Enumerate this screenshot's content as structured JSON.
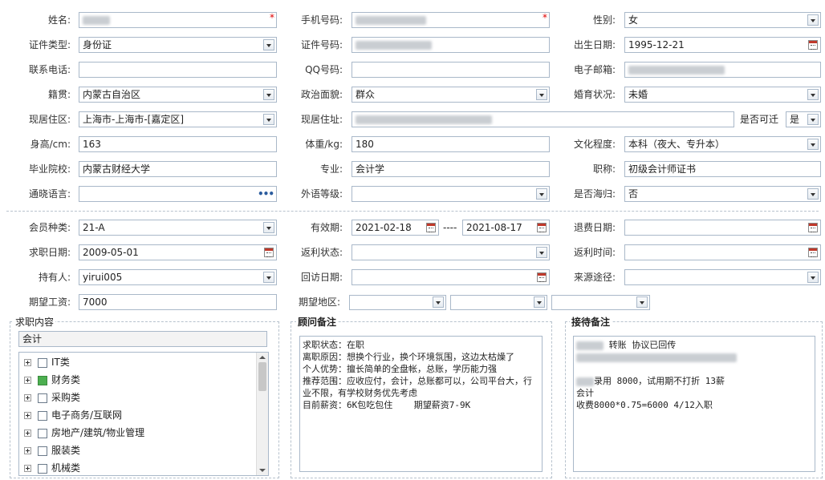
{
  "row1": {
    "name_label": "姓名:",
    "phone_label": "手机号码:",
    "gender_label": "性别:",
    "gender_value": "女",
    "required_mark": "*"
  },
  "row2": {
    "idtype_label": "证件类型:",
    "idtype_value": "身份证",
    "idno_label": "证件号码:",
    "birth_label": "出生日期:",
    "birth_value": "1995-12-21"
  },
  "row3": {
    "tel_label": "联系电话:",
    "qq_label": "QQ号码:",
    "email_label": "电子邮箱:"
  },
  "row4": {
    "native_label": "籍贯:",
    "native_value": "内蒙古自治区",
    "political_label": "政治面貌:",
    "political_value": "群众",
    "marital_label": "婚育状况:",
    "marital_value": "未婚"
  },
  "row5": {
    "residence_label": "现居住区:",
    "residence_value": "上海市-上海市-[嘉定区]",
    "address_label": "现居住址:",
    "relocate_label": "是否可迁",
    "relocate_value": "是"
  },
  "row6": {
    "height_label": "身高/cm:",
    "height_value": "163",
    "weight_label": "体重/kg:",
    "weight_value": "180",
    "edu_label": "文化程度:",
    "edu_value": "本科（夜大、专升本）"
  },
  "row7": {
    "school_label": "毕业院校:",
    "school_value": "内蒙古财经大学",
    "major_label": "专业:",
    "major_value": "会计学",
    "title_label": "职称:",
    "title_value": "初级会计师证书"
  },
  "row8": {
    "lang_label": "通晓语言:",
    "lang_more": "•••",
    "foreign_label": "外语等级:",
    "overseas_label": "是否海归:",
    "overseas_value": "否"
  },
  "row9": {
    "member_label": "会员种类:",
    "member_value": "21-A",
    "valid_label": "有效期:",
    "valid_from": "2021-02-18",
    "valid_dash": "----",
    "valid_to": "2021-08-17",
    "refund_label": "退费日期:"
  },
  "row10": {
    "jobdate_label": "求职日期:",
    "jobdate_value": "2009-05-01",
    "rebate_status_label": "返利状态:",
    "rebate_time_label": "返利时间:"
  },
  "row11": {
    "holder_label": "持有人:",
    "holder_value": "yirui005",
    "visit_label": "回访日期:",
    "source_label": "来源途径:"
  },
  "row12": {
    "salary_label": "期望工资:",
    "salary_value": "7000",
    "area_label": "期望地区:"
  },
  "job_panel": {
    "title": "求职内容",
    "selected": "会计",
    "items": [
      {
        "label": "IT类",
        "checked": false
      },
      {
        "label": "财务类",
        "checked": true
      },
      {
        "label": "采购类",
        "checked": false
      },
      {
        "label": "电子商务/互联网",
        "checked": false
      },
      {
        "label": "房地产/建筑/物业管理",
        "checked": false
      },
      {
        "label": "服装类",
        "checked": false
      },
      {
        "label": "机械类",
        "checked": false
      }
    ]
  },
  "advisor_panel": {
    "title": "顾问备注",
    "text": "求职状态：在职\n离职原因：想换个行业，换个环境氛围，这边太枯燥了\n个人优势：擅长简单的全盘帐，总账，学历能力强\n推荐范围：应收应付，会计，总账都可以，公司平台大，行业不限，有学校财务优先考虑\n目前薪资：6K包吃包住    期望薪资7-9K"
  },
  "reception_panel": {
    "title": "接待备注",
    "line1_suffix": " 转账 协议已回传",
    "line3_suffix": "录用  8000，试用期不打折  13薪",
    "line4": "会计",
    "line5": "收费8000*0.75=6000  4/12入职"
  }
}
